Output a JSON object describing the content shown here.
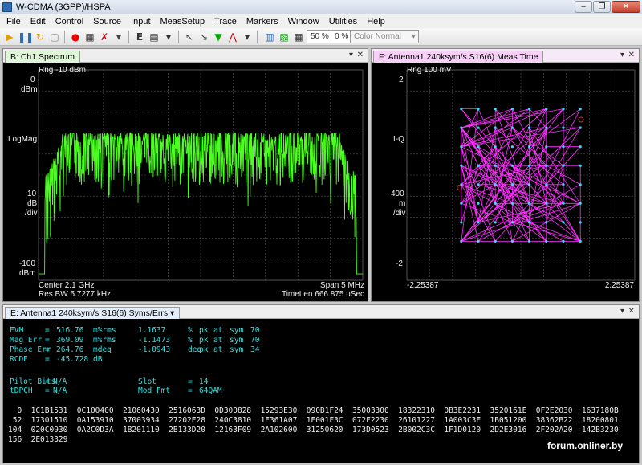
{
  "app": {
    "title": "W-CDMA (3GPP)/HSPA"
  },
  "menu": [
    "File",
    "Edit",
    "Control",
    "Source",
    "Input",
    "MeasSetup",
    "Trace",
    "Markers",
    "Window",
    "Utilities",
    "Help"
  ],
  "toolbar": {
    "zoom1": "50 %",
    "zoom2": "0 %",
    "color_mode": "Color Normal"
  },
  "spectrum": {
    "tab": "B: Ch1 Spectrum",
    "rng": "Rng -10 dBm",
    "y_top_val": "0",
    "y_top_unit": "dBm",
    "y_scale_label": "LogMag",
    "y_div_val": "10",
    "y_div_unit1": "dB",
    "y_div_unit2": "/div",
    "y_bottom_val": "-100",
    "y_bottom_unit": "dBm",
    "center": "Center 2.1 GHz",
    "res_bw": "Res BW 5.7277 kHz",
    "span": "Span 5 MHz",
    "timelen": "TimeLen 666.875 uSec",
    "trace_color": "#4cff20"
  },
  "constellation": {
    "tab": "F: Antenna1 240ksym/s S16(6) Meas Time",
    "rng": "Rng 100 mV",
    "y_top": "2",
    "y_label": "I-Q",
    "y_div_val": "400",
    "y_div_unit1": "m",
    "y_div_unit2": "/div",
    "y_bottom": "-2",
    "x_left": "-2.25387",
    "x_right": "2.25387",
    "trace_color": "#ff30ff",
    "point_color": "#40d8ff"
  },
  "syms": {
    "tab": "E: Antenna1 240ksym/s S16(6) Syms/Errs",
    "rows": [
      [
        "EVM",
        "=",
        "516.76",
        "m%rms",
        "1.1637",
        "%",
        "pk",
        "at",
        "sym",
        "70"
      ],
      [
        "Mag Err",
        "=",
        "369.09",
        "m%rms",
        "-1.1473",
        "%",
        "pk",
        "at",
        "sym",
        "70"
      ],
      [
        "Phase Err",
        "=",
        "264.76",
        "mdeg",
        "-1.0943",
        "deg",
        "pk",
        "at",
        "sym",
        "34"
      ],
      [
        "RCDE",
        "=",
        "-45.728",
        "dB",
        "",
        "",
        "",
        "",
        "",
        ""
      ]
    ],
    "pilot_bits_label": "Pilot Bits",
    "pilot_bits_val": "N/A",
    "tdpch_label": "tDPCH",
    "tdpch_val": "N/A",
    "slot_label": "Slot",
    "slot_val": "14",
    "modfmt_label": "Mod Fmt",
    "modfmt_val": "64QAM",
    "hex": [
      "  0  1C1B1531  0C100400  21060430  2516063D  0D300828  15293E30  090B1F24  35003300  18322310  0B3E2231  3520161E  0F2E2030  1637180B",
      " 52  17301510  0A153910  37003934  27202E28  240C3810  1E361A07  1E001F3C  072F2230  26101227  1A003C3E  1B051200  38362B22  18200801",
      "104  020C0930  0A2C0D3A  1B201110  2B133D20  12163F09  2A102600  31250620  173D0523  2B002C3C  1F1D0120  2D2E3016  2F202A20  142B3230",
      "156  2E013329"
    ]
  },
  "watermark": "forum.onliner.by"
}
